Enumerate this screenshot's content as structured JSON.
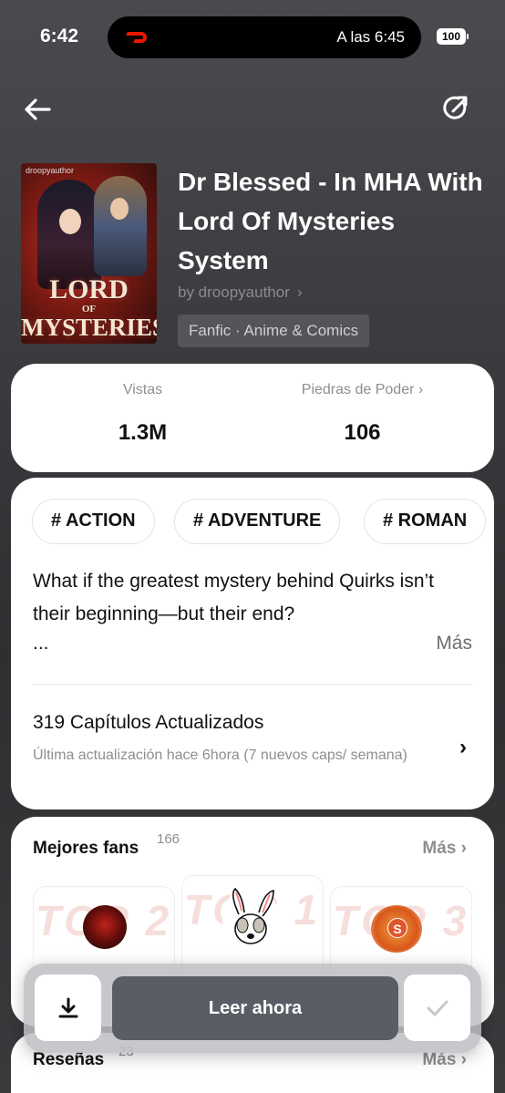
{
  "status_bar": {
    "time": "6:42",
    "activity_text": "A las 6:45",
    "battery": "100"
  },
  "nav": {
    "back_icon": "arrow-left-icon",
    "share_icon": "share-icon"
  },
  "book": {
    "cover_author": "droopyauthor",
    "cover_title_line1": "LORD",
    "cover_title_line2": "OF",
    "cover_title_line3": "MYSTERIES",
    "title": "Dr Blessed - In MHA With Lord Of Mysteries System",
    "author": "by droopyauthor",
    "genre": "Fanfic · Anime & Comics"
  },
  "stats": {
    "views_label": "Vistas",
    "views_value": "1.3M",
    "power_label": "Piedras de Poder",
    "power_value": "106"
  },
  "tags": [
    "# ACTION",
    "# ADVENTURE",
    "# ROMAN"
  ],
  "synopsis": {
    "text": "What if the greatest mystery behind Quirks isn’t their beginning—but their end?",
    "ellipsis": "...",
    "more": "Más"
  },
  "chapters": {
    "title": "319 Capítulos Actualizados",
    "subtitle": "Última actualización hace 6hora (7 nuevos caps/ semana)"
  },
  "fans": {
    "title": "Mejores fans",
    "count": "166",
    "more": "Más",
    "ranks": [
      "TOP 2",
      "TOP 1",
      "TOP 3"
    ],
    "avatar3_letter": "S"
  },
  "reviews": {
    "title": "Reseñas",
    "count": "23",
    "more": "Más"
  },
  "actions": {
    "read_now": "Leer ahora",
    "download_icon": "download-icon",
    "library_icon": "checkmark-icon"
  },
  "colors": {
    "accent_red": "#eb1700",
    "read_button": "#5b5d66"
  }
}
